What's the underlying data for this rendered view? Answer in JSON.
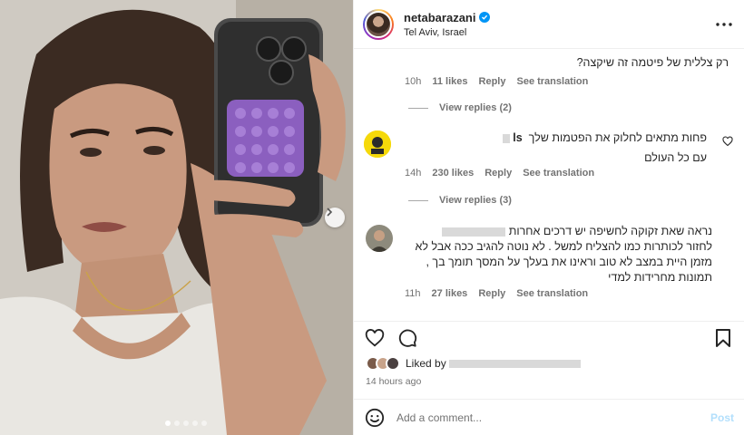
{
  "post": {
    "carousel": {
      "total_images": 5,
      "active_index": 0
    }
  },
  "header": {
    "username": "netabarazani",
    "location": "Tel Aviv, Israel"
  },
  "comments": [
    {
      "text": "רק צללית של פיטמה זה שיקצה?",
      "time": "10h",
      "likes": "11 likes",
      "reply_label": "Reply",
      "translation_label": "See translation",
      "view_replies": "View replies (2)"
    },
    {
      "user_suffix": "ls",
      "text_line1": "פחות מתאים לחלוק את הפטמות שלך",
      "text_line2": "עם כל העולם",
      "time": "14h",
      "likes": "230 likes",
      "reply_label": "Reply",
      "translation_label": "See translation",
      "view_replies": "View replies (3)"
    },
    {
      "lines": [
        "נראה שאת זקוקה לחשיפה יש דרכים אחרות",
        "לחזור לכותרות כמו להצליח למשל . לא נוטה להגיב ככה אבל לא",
        "מזמן היית במצב לא טוב וראינו את בעלך על המסך תומך בך ,",
        "תמונות מחרידות למדי"
      ],
      "time": "11h",
      "likes": "27 likes",
      "reply_label": "Reply",
      "translation_label": "See translation"
    }
  ],
  "likes_summary": {
    "liked_prefix": "Liked by"
  },
  "timestamp": "14 hours ago",
  "add_comment": {
    "placeholder": "Add a comment...",
    "post_label": "Post"
  },
  "colors": {
    "link_blue": "#0095f6",
    "post_disabled": "#b2dffc",
    "secondary_text": "#737373"
  },
  "icons": [
    "heart-icon",
    "comment-icon",
    "bookmark-icon",
    "emoji-icon",
    "more-icon",
    "verified-icon",
    "chevron-right-icon"
  ]
}
